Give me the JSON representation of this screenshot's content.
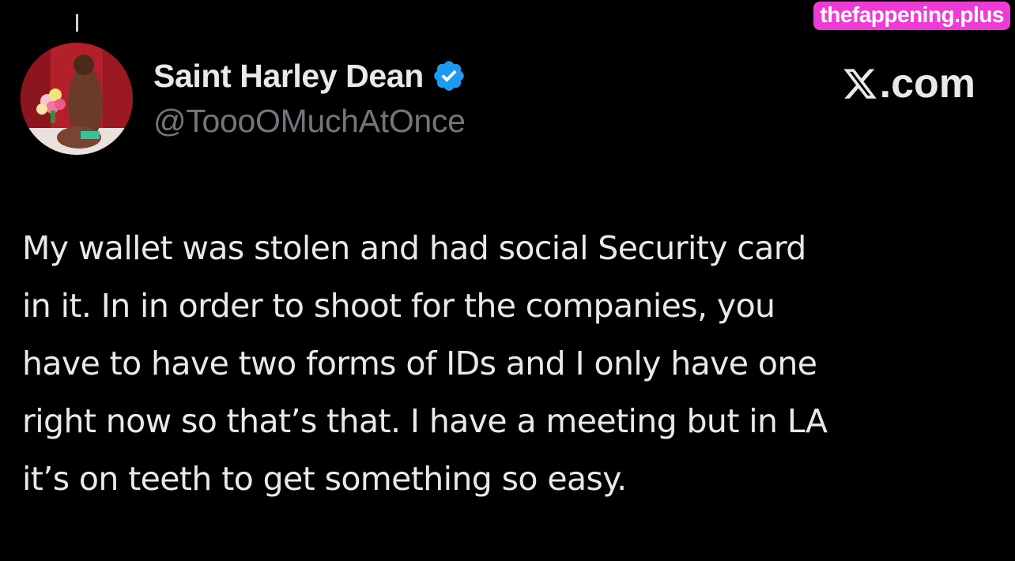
{
  "watermark": {
    "text": "thefappening.plus",
    "color": "#ee3bd6"
  },
  "author": {
    "display_name": "Saint Harley Dean",
    "handle": "@ToooOMuchAtOnce",
    "verified": true,
    "verified_icon": "verified-badge-icon",
    "verified_color": "#1d9bf0",
    "avatar": "profile-photo"
  },
  "brand": {
    "logo_icon": "x-logo-icon",
    "suffix": ".com"
  },
  "tweet": {
    "text": "My wallet was stolen and had social Security card\nin it. In in order to shoot for the companies, you\nhave to have two forms of IDs and I only have one\nright now so that’s that. I have a meeting but in LA\nit’s on teeth to get something so easy."
  },
  "colors": {
    "background": "#000000",
    "primary_text": "#e7e9ea",
    "secondary_text": "#71767b"
  }
}
